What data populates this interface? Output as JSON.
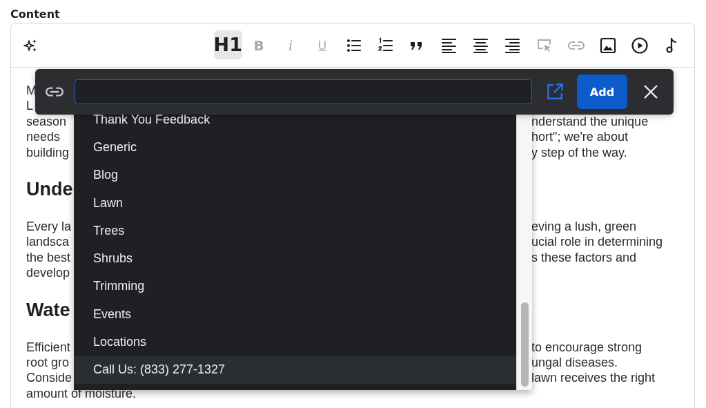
{
  "field_label": "Content",
  "toolbar": {
    "format_buttons": [
      {
        "kind": "heading",
        "label": "H1",
        "active": true,
        "disabled": false
      },
      {
        "kind": "bold",
        "label": "B",
        "active": false,
        "disabled": true
      },
      {
        "kind": "italic",
        "label": "i",
        "active": false,
        "disabled": true
      },
      {
        "kind": "underline",
        "label": "U",
        "active": false,
        "disabled": true
      }
    ],
    "icon_buttons": [
      {
        "disabled": false
      },
      {
        "disabled": false
      },
      {
        "disabled": false
      },
      {
        "disabled": false
      },
      {
        "disabled": false
      },
      {
        "disabled": false
      },
      {
        "disabled": true
      },
      {
        "disabled": true
      },
      {
        "disabled": false
      },
      {
        "disabled": false
      },
      {
        "disabled": false
      }
    ]
  },
  "document": [
    {
      "kind": "paragraph",
      "lines": [
        {
          "left": "M"
        },
        {
          "left": "L"
        },
        {
          "left": "season",
          "right": "nderstand the unique"
        },
        {
          "left": "needs",
          "right": "hort\"; we're about"
        },
        {
          "left": "building",
          "right": "y step of the way."
        }
      ]
    },
    {
      "kind": "heading",
      "text": "Unde"
    },
    {
      "kind": "paragraph",
      "lines": [
        {
          "left": "Every la",
          "right": "eving a lush, green"
        },
        {
          "left": "landsca",
          "right": "ucial role in determining"
        },
        {
          "left": "the best",
          "right": "s these factors and"
        },
        {
          "left": "develop"
        }
      ]
    },
    {
      "kind": "heading",
      "text": "Wate"
    },
    {
      "kind": "paragraph",
      "lines": [
        {
          "left": "Efficient",
          "right": "to encourage strong"
        },
        {
          "left": "root gro",
          "right": "ungal diseases."
        },
        {
          "left": "Conside",
          "right": "lawn receives the right"
        },
        {
          "left": "amount of moisture."
        }
      ]
    }
  ],
  "link_popup": {
    "url_field": {
      "focused": true
    },
    "add_button": "Add",
    "suggestions": [
      {
        "label": "Thank You Feedback",
        "selected": false
      },
      {
        "label": "Generic",
        "selected": false
      },
      {
        "label": "Blog",
        "selected": false
      },
      {
        "label": "Lawn",
        "selected": false
      },
      {
        "label": "Trees",
        "selected": false
      },
      {
        "label": "Shrubs",
        "selected": false
      },
      {
        "label": "Trimming",
        "selected": false
      },
      {
        "label": "Events",
        "selected": false
      },
      {
        "label": "Locations",
        "selected": false
      },
      {
        "label": "Call Us: (833) 277-1327",
        "selected": true
      }
    ]
  }
}
